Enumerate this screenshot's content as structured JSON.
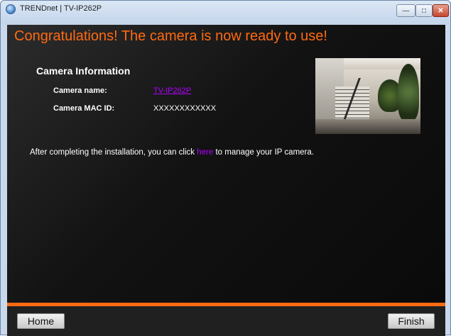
{
  "window": {
    "title": "TRENDnet | TV-IP262P",
    "controls": {
      "minimize": "—",
      "maximize": "□",
      "close": "✕"
    }
  },
  "content": {
    "headline": "Congratulations! The camera is now ready to use!",
    "section_title": "Camera Information",
    "rows": [
      {
        "label": "Camera name:",
        "value": "TV-IP262P"
      },
      {
        "label": "Camera MAC ID:",
        "value": "XXXXXXXXXXXX"
      }
    ],
    "note": {
      "before": "After completing the installation, you can click ",
      "link": "here",
      "after": " to manage your IP camera."
    }
  },
  "footer": {
    "home_label": "Home",
    "finish_label": "Finish"
  },
  "colors": {
    "accent": "#ff6a12",
    "link": "#b000ff",
    "background": "#121212"
  }
}
